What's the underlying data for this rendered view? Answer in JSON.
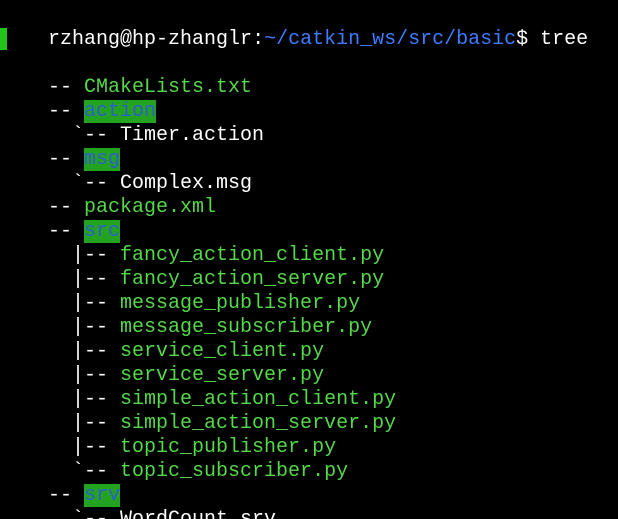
{
  "prompt": {
    "user_host": "rzhang@hp-zhanglr",
    "colon": ":",
    "path": "~/catkin_ws/src/basic",
    "symbol": "$",
    "command": " tree"
  },
  "tree": {
    "line1": {
      "prefix": "-- ",
      "name": "CMakeLists.txt"
    },
    "line2": {
      "prefix": "-- ",
      "name": "action"
    },
    "line3": {
      "prefix": "  `-- ",
      "name": "Timer.action"
    },
    "line4": {
      "prefix": "-- ",
      "name": "msg"
    },
    "line5": {
      "prefix": "  `-- ",
      "name": "Complex.msg"
    },
    "line6": {
      "prefix": "-- ",
      "name": "package.xml"
    },
    "line7": {
      "prefix": "-- ",
      "name": "src"
    },
    "src_prefix": "  |-- ",
    "src_last_prefix": "  `-- ",
    "src_files": [
      "fancy_action_client.py",
      "fancy_action_server.py",
      "message_publisher.py",
      "message_subscriber.py",
      "service_client.py",
      "service_server.py",
      "simple_action_client.py",
      "simple_action_server.py",
      "topic_publisher.py",
      "topic_subscriber.py"
    ],
    "line18": {
      "prefix": "-- ",
      "name": "srv"
    },
    "line19": {
      "prefix": "  `-- ",
      "name": "WordCount.srv"
    }
  },
  "colors": {
    "background": "#000000",
    "text": "#ffffff",
    "file_green": "#55d74a",
    "path_blue": "#3f7bff",
    "dir_highlight_bg": "#23a31f",
    "dir_text": "#2b5ecf"
  }
}
